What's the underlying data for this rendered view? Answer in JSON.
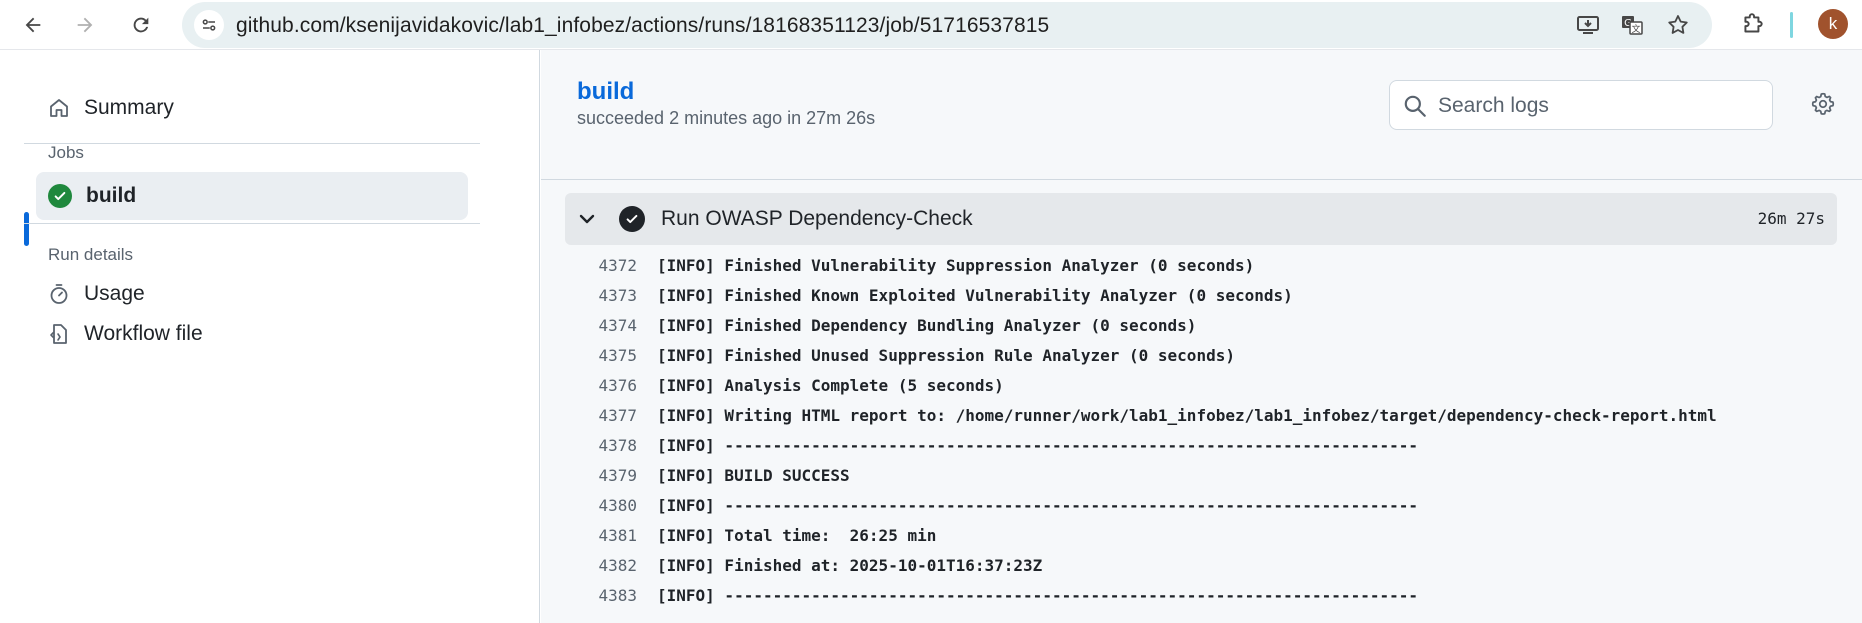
{
  "browser": {
    "url": "github.com/ksenijavidakovic/lab1_infobez/actions/runs/18168351123/job/51716537815",
    "avatar_letter": "k"
  },
  "sidebar": {
    "summary_label": "Summary",
    "jobs_heading": "Jobs",
    "build_label": "build",
    "run_details_heading": "Run details",
    "usage_label": "Usage",
    "workflow_label": "Workflow file"
  },
  "job": {
    "title": "build",
    "subtitle": "succeeded 2 minutes ago in 27m 26s"
  },
  "search": {
    "placeholder": "Search logs"
  },
  "step": {
    "name": "Run OWASP Dependency-Check",
    "duration": "26m 27s"
  },
  "log_lines": [
    {
      "num": "4372",
      "text": "[INFO] Finished Vulnerability Suppression Analyzer (0 seconds)"
    },
    {
      "num": "4373",
      "text": "[INFO] Finished Known Exploited Vulnerability Analyzer (0 seconds)"
    },
    {
      "num": "4374",
      "text": "[INFO] Finished Dependency Bundling Analyzer (0 seconds)"
    },
    {
      "num": "4375",
      "text": "[INFO] Finished Unused Suppression Rule Analyzer (0 seconds)"
    },
    {
      "num": "4376",
      "text": "[INFO] Analysis Complete (5 seconds)"
    },
    {
      "num": "4377",
      "text": "[INFO] Writing HTML report to: /home/runner/work/lab1_infobez/lab1_infobez/target/dependency-check-report.html"
    },
    {
      "num": "4378",
      "text": "[INFO] ------------------------------------------------------------------------"
    },
    {
      "num": "4379",
      "text": "[INFO] BUILD SUCCESS"
    },
    {
      "num": "4380",
      "text": "[INFO] ------------------------------------------------------------------------"
    },
    {
      "num": "4381",
      "text": "[INFO] Total time:  26:25 min"
    },
    {
      "num": "4382",
      "text": "[INFO] Finished at: 2025-10-01T16:37:23Z"
    },
    {
      "num": "4383",
      "text": "[INFO] ------------------------------------------------------------------------"
    }
  ],
  "colors": {
    "accent": "#0969da",
    "success": "#1f883d"
  }
}
